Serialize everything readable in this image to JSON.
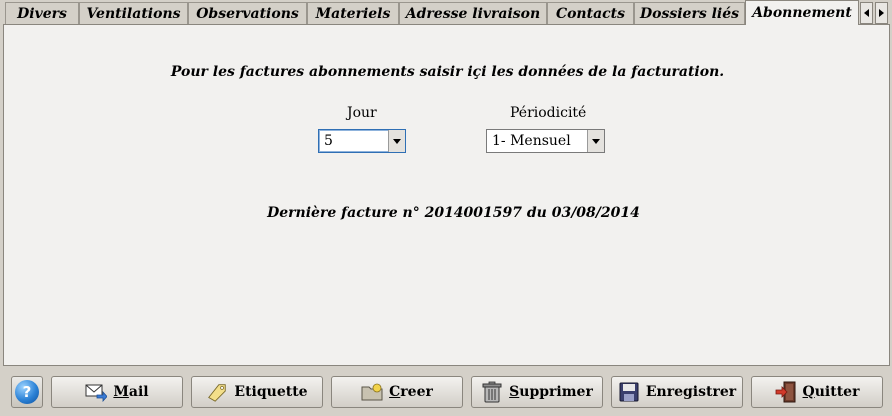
{
  "tabs": [
    {
      "label": "Divers",
      "active": false
    },
    {
      "label": "Ventilations",
      "active": false
    },
    {
      "label": "Observations",
      "active": false
    },
    {
      "label": "Materiels",
      "active": false
    },
    {
      "label": "Adresse livraison",
      "active": false
    },
    {
      "label": "Contacts",
      "active": false
    },
    {
      "label": "Dossiers liés",
      "active": false
    },
    {
      "label": "Abonnement",
      "active": true
    }
  ],
  "panel": {
    "heading": "Pour les factures abonnements saisir içi les données de la facturation.",
    "jour": {
      "label": "Jour",
      "value": "5"
    },
    "periodicite": {
      "label": "Périodicité",
      "value": "1- Mensuel"
    },
    "last_invoice": "Dernière facture n° 2014001597 du 03/08/2014"
  },
  "toolbar": {
    "help_icon_glyph": "?",
    "mail": "Mail",
    "etiquette": "Etiquette",
    "creer": "Creer",
    "supprimer": "Supprimer",
    "enregistrer": "Enregistrer",
    "quitter": "Quitter"
  },
  "colors": {
    "window_bg": "#d4d0c8",
    "panel_bg": "#f2f1ef",
    "focus_border": "#2f6fb4"
  }
}
